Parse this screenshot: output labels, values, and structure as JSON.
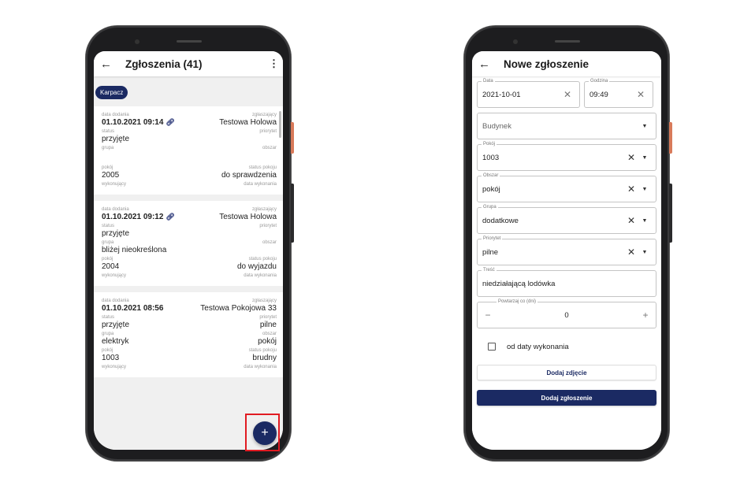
{
  "colors": {
    "accent": "#1b2a63",
    "highlight": "#e11b22"
  },
  "left": {
    "title": "Zgłoszenia (41)",
    "back_icon": "arrow-left-icon",
    "menu_icon": "more-vertical-icon",
    "filter_chip": "Karpacz",
    "labels": {
      "date_added": "data dodania",
      "reporter": "zgłaszający",
      "status": "status",
      "priority": "priorytet",
      "group": "grupa",
      "area": "obszar",
      "room": "pokój",
      "room_status": "status pokoju",
      "assignee": "wykonujący",
      "done_date": "data wykonania"
    },
    "cards": [
      {
        "date": "01.10.2021 09:14",
        "reporter": "Testowa Holowa",
        "status": "przyjęte",
        "priority": "",
        "group": "",
        "area": "",
        "room": "2005",
        "room_status": "do sprawdzenia"
      },
      {
        "date": "01.10.2021 09:12",
        "reporter": "Testowa Holowa",
        "status": "przyjęte",
        "priority": "",
        "group": "bliżej nieokreślona",
        "area": "",
        "room": "2004",
        "room_status": "do wyjazdu"
      },
      {
        "date": "01.10.2021 08:56",
        "reporter": "Testowa Pokojowa 33",
        "status": "przyjęte",
        "priority": "pilne",
        "group": "elektryk",
        "area": "pokój",
        "room": "1003",
        "room_status": "brudny"
      }
    ],
    "fab_label": "+"
  },
  "right": {
    "title": "Nowe zgłoszenie",
    "back_icon": "arrow-left-icon",
    "date": {
      "label": "Data",
      "value": "2021-10-01"
    },
    "time": {
      "label": "Godzina",
      "value": "09:49"
    },
    "building": {
      "placeholder": "Budynek"
    },
    "room": {
      "label": "Pokój",
      "value": "1003"
    },
    "area": {
      "label": "Obszar",
      "value": "pokój"
    },
    "group": {
      "label": "Grupa",
      "value": "dodatkowe"
    },
    "priority": {
      "label": "Priorytet",
      "value": "pilne"
    },
    "content": {
      "label": "Treść",
      "value": "niedziałającą lodówka"
    },
    "repeat": {
      "label": "Powtarzaj co (dni)",
      "value": "0"
    },
    "checkbox_label": "od daty wykonania",
    "add_photo": "Dodaj zdjęcie",
    "submit": "Dodaj zgłoszenie"
  }
}
